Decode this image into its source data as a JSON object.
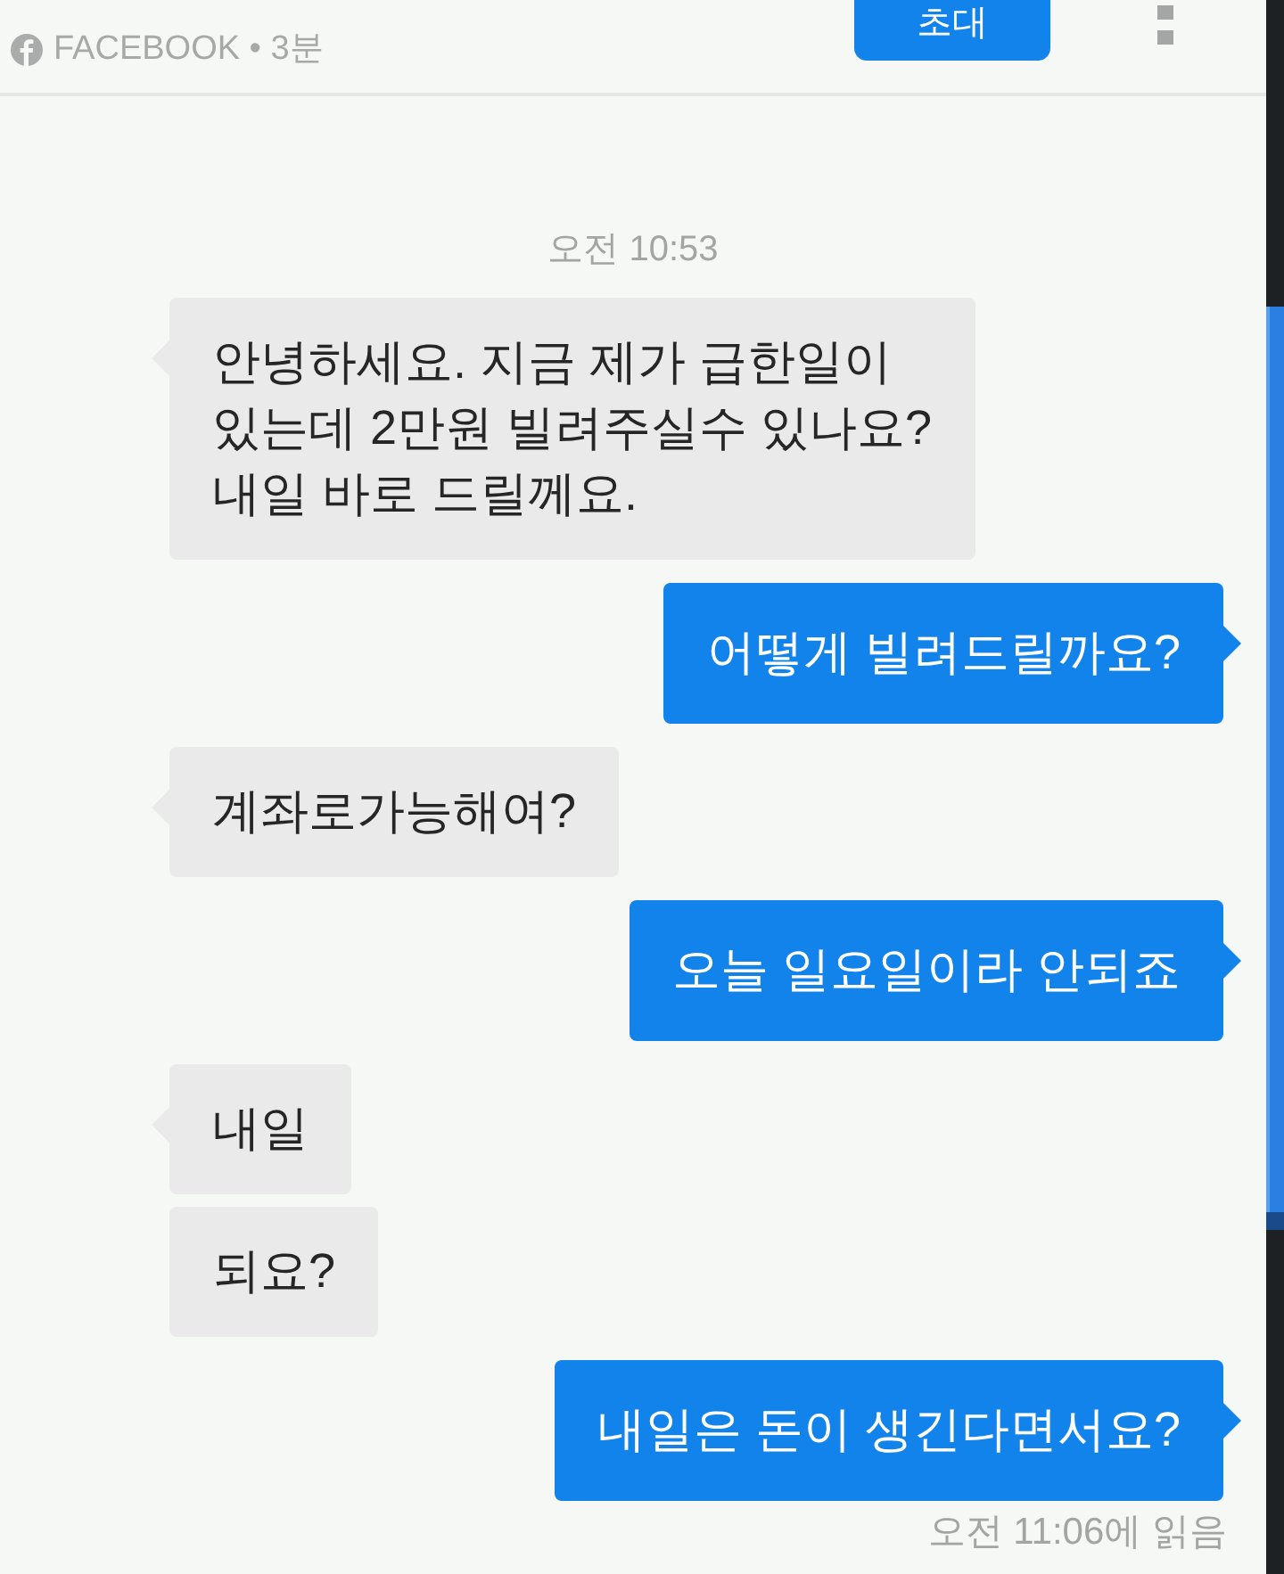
{
  "header": {
    "subtitle": "FACEBOOK • 3분",
    "invite_button": "초대"
  },
  "conversation": [
    {
      "kind": "timestamp",
      "text": "오전 10:53"
    },
    {
      "kind": "received",
      "text": "안녕하세요. 지금 제가 급한일이\n있는데 2만원 빌려주실수 있나요?\n내일 바로 드릴께요.",
      "tail": true
    },
    {
      "kind": "sent",
      "text": "어떻게 빌려드릴까요?",
      "tail": true
    },
    {
      "kind": "received",
      "text": "계좌로가능해여?",
      "tail": true
    },
    {
      "kind": "sent",
      "text": "오늘 일요일이라 안되죠",
      "tail": true
    },
    {
      "kind": "received",
      "text": "내일",
      "tail": true
    },
    {
      "kind": "received",
      "text": "되요?",
      "tail": false
    },
    {
      "kind": "sent",
      "text": "내일은 돈이 생긴다면서요?",
      "tail": true
    },
    {
      "kind": "receipt",
      "text": "오전 11:06에 읽음"
    }
  ]
}
